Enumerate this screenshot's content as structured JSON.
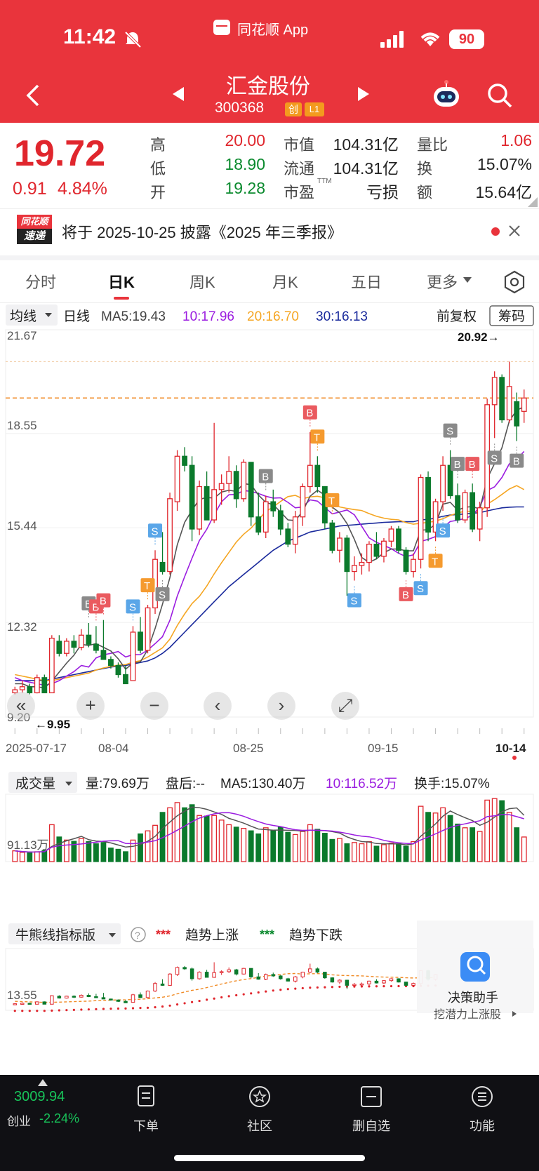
{
  "status_bar": {
    "time": "11:42",
    "battery": "90",
    "app_title": "同花顺 App"
  },
  "header": {
    "stock_name": "汇金股份",
    "stock_code": "300368",
    "badge_board": "创",
    "badge_level": "L1"
  },
  "quote": {
    "price": "19.72",
    "change": "0.91",
    "change_pct": "4.84%",
    "high_label": "高",
    "high": "20.00",
    "low_label": "低",
    "low": "18.90",
    "open_label": "开",
    "open": "19.28",
    "mktcap_label": "市值",
    "mktcap": "104.31亿",
    "float_label": "流通",
    "float_cap": "104.31亿",
    "pe_label": "市盈",
    "pe_sup": "TTM",
    "pe": "亏损",
    "vol_ratio_label": "量比",
    "vol_ratio": "1.06",
    "turnover_label": "换",
    "turnover": "15.07%",
    "amount_label": "额",
    "amount": "15.64亿"
  },
  "notice": {
    "logo_top": "同花顺",
    "logo_bottom": "速递",
    "text": "将于 2025-10-25 披露《2025 年三季报》"
  },
  "tabs": [
    "分时",
    "日K",
    "周K",
    "月K",
    "五日",
    "更多"
  ],
  "active_tab": 1,
  "kline": {
    "ma_selector": "均线",
    "period": "日线",
    "ma5": "MA5:19.43",
    "ma10": "10:17.96",
    "ma20": "20:16.70",
    "ma30": "30:16.13",
    "adjust": "前复权",
    "chips": "筹码",
    "y_labels": [
      "21.67",
      "18.55",
      "15.44",
      "12.32",
      "9.20"
    ],
    "high_note": "20.92→",
    "low_note": "←9.95",
    "dates": [
      "2025-07-17",
      "08-04",
      "08-25",
      "09-15",
      "10-14"
    ]
  },
  "volume": {
    "selector": "成交量",
    "vol": "量:79.69万",
    "after_hours": "盘后:--",
    "ma5": "MA5:130.40万",
    "ma10": "10:116.52万",
    "turnover": "换手:15.07%",
    "y_label": "91.13万"
  },
  "indicator": {
    "selector": "牛熊线指标版",
    "up_label": "趋势上涨",
    "down_label": "趋势下跌",
    "y_label": "13.55",
    "assistant_title": "决策助手",
    "assistant_sub": "挖潜力上涨股"
  },
  "bottom_bar": {
    "index_value": "3009.94",
    "index_name": "创业",
    "index_change": "-2.24%",
    "items": [
      "下单",
      "社区",
      "删自选",
      "功能"
    ]
  },
  "colors": {
    "up": "#e0262d",
    "down": "#0b7a2c",
    "ma5": "#555555",
    "ma10": "#9b1de0",
    "ma20": "#f5a623",
    "ma30": "#1a2a9c"
  },
  "chart_data": {
    "type": "candlestick",
    "title": "",
    "xlabel": "",
    "ylabel": "",
    "ylim": [
      9.2,
      21.67
    ],
    "x_ticks": [
      "2025-07-17",
      "08-04",
      "08-25",
      "09-15",
      "10-14"
    ],
    "candles": [
      [
        10.0,
        10.2,
        9.95,
        10.1
      ],
      [
        10.1,
        10.4,
        10.0,
        10.2
      ],
      [
        10.2,
        10.3,
        9.95,
        10.0
      ],
      [
        10.0,
        10.6,
        9.98,
        10.5
      ],
      [
        10.5,
        10.6,
        10.0,
        10.0
      ],
      [
        10.0,
        11.9,
        10.0,
        11.8
      ],
      [
        11.7,
        11.9,
        11.2,
        11.3
      ],
      [
        11.3,
        11.8,
        11.2,
        11.7
      ],
      [
        11.7,
        11.9,
        11.3,
        11.5
      ],
      [
        11.5,
        12.1,
        11.4,
        11.9
      ],
      [
        11.9,
        12.3,
        11.5,
        11.6
      ],
      [
        11.6,
        12.2,
        11.3,
        11.4
      ],
      [
        11.4,
        12.4,
        11.1,
        11.1
      ],
      [
        11.1,
        11.2,
        10.8,
        10.9
      ],
      [
        10.9,
        11.0,
        10.5,
        10.6
      ],
      [
        10.6,
        10.9,
        10.3,
        10.3
      ],
      [
        10.4,
        12.2,
        10.4,
        12.0
      ],
      [
        12.0,
        12.5,
        11.3,
        11.4
      ],
      [
        11.4,
        12.9,
        11.3,
        12.8
      ],
      [
        12.8,
        14.7,
        12.6,
        14.4
      ],
      [
        14.3,
        15.3,
        13.9,
        14.0
      ],
      [
        14.0,
        16.6,
        13.9,
        16.4
      ],
      [
        16.3,
        18.0,
        16.0,
        17.8
      ],
      [
        17.8,
        18.1,
        17.3,
        17.5
      ],
      [
        17.5,
        17.8,
        15.0,
        15.4
      ],
      [
        15.4,
        17.0,
        15.2,
        16.8
      ],
      [
        16.8,
        17.3,
        15.7,
        15.7
      ],
      [
        15.7,
        18.9,
        15.6,
        16.7
      ],
      [
        16.7,
        17.2,
        16.2,
        16.9
      ],
      [
        16.9,
        17.8,
        16.6,
        17.3
      ],
      [
        17.3,
        17.5,
        16.1,
        16.4
      ],
      [
        16.4,
        17.7,
        16.3,
        17.6
      ],
      [
        17.6,
        17.6,
        15.5,
        15.8
      ],
      [
        15.8,
        16.6,
        15.2,
        15.3
      ],
      [
        15.3,
        16.5,
        15.1,
        16.3
      ],
      [
        16.3,
        16.7,
        15.8,
        16.0
      ],
      [
        16.0,
        16.2,
        15.2,
        15.4
      ],
      [
        15.4,
        15.6,
        14.8,
        14.9
      ],
      [
        14.9,
        16.0,
        14.6,
        15.8
      ],
      [
        15.8,
        16.9,
        15.5,
        16.8
      ],
      [
        16.8,
        18.6,
        16.6,
        17.5
      ],
      [
        17.5,
        17.8,
        16.6,
        16.8
      ],
      [
        16.8,
        16.8,
        15.4,
        15.6
      ],
      [
        15.6,
        15.7,
        14.6,
        14.7
      ],
      [
        14.7,
        15.3,
        14.3,
        15.1
      ],
      [
        15.1,
        15.2,
        13.2,
        14.0
      ],
      [
        14.0,
        14.5,
        13.7,
        14.2
      ],
      [
        14.2,
        14.6,
        13.9,
        14.3
      ],
      [
        14.3,
        15.0,
        14.0,
        14.9
      ],
      [
        14.9,
        15.3,
        14.4,
        14.5
      ],
      [
        14.5,
        15.1,
        14.3,
        15.0
      ],
      [
        15.0,
        15.5,
        14.8,
        15.4
      ],
      [
        15.4,
        15.5,
        14.6,
        14.7
      ],
      [
        14.7,
        14.8,
        13.9,
        14.0
      ],
      [
        14.0,
        14.6,
        13.8,
        14.4
      ],
      [
        14.4,
        17.2,
        14.1,
        17.1
      ],
      [
        17.1,
        17.3,
        15.0,
        15.3
      ],
      [
        15.3,
        16.4,
        15.0,
        16.3
      ],
      [
        16.3,
        17.8,
        16.0,
        17.5
      ],
      [
        17.5,
        18.0,
        16.4,
        16.5
      ],
      [
        16.5,
        16.9,
        15.6,
        15.7
      ],
      [
        15.7,
        16.7,
        15.6,
        16.6
      ],
      [
        16.6,
        16.9,
        15.3,
        15.4
      ],
      [
        15.4,
        16.3,
        15.0,
        16.1
      ],
      [
        16.1,
        19.7,
        15.8,
        19.5
      ],
      [
        19.5,
        20.6,
        18.4,
        20.4
      ],
      [
        20.4,
        20.5,
        18.9,
        19.0
      ],
      [
        19.0,
        20.92,
        18.9,
        20.1
      ],
      [
        19.6,
        19.9,
        18.3,
        18.8
      ],
      [
        19.28,
        20.0,
        18.9,
        19.72
      ]
    ],
    "ma5": [
      10.3,
      10.3,
      10.2,
      10.2,
      10.16,
      10.38,
      10.68,
      10.98,
      11.24,
      11.6,
      11.56,
      11.62,
      11.5,
      11.38,
      11.12,
      10.78,
      10.98,
      11.02,
      11.42,
      12.12,
      12.92,
      13.8,
      14.88,
      15.62,
      16.02,
      16.38,
      16.44,
      16.42,
      16.62,
      16.68,
      16.64,
      16.9,
      16.86,
      16.52,
      16.28,
      16.2,
      15.96,
      15.7,
      15.68,
      15.98,
      16.48,
      16.68,
      16.52,
      16.12,
      15.94,
      15.58,
      15.06,
      14.46,
      14.3,
      14.42,
      14.62,
      14.74,
      14.74,
      14.68,
      14.68,
      15.36,
      15.38,
      15.56,
      16.22,
      16.28,
      16.02,
      16.12,
      16.14,
      16.06,
      17.06,
      17.56,
      18.08,
      18.96,
      19.32,
      19.43
    ],
    "ma10": [
      10.5,
      10.4,
      10.35,
      10.3,
      10.25,
      10.3,
      10.4,
      10.55,
      10.7,
      10.9,
      10.85,
      11.15,
      11.25,
      11.3,
      11.36,
      11.18,
      11.26,
      11.26,
      11.41,
      11.62,
      11.85,
      12.39,
      13.19,
      13.83,
      14.44,
      15.02,
      15.39,
      15.87,
      16.3,
      16.53,
      16.54,
      16.67,
      16.64,
      16.57,
      16.48,
      16.42,
      16.43,
      16.28,
      16.1,
      16.13,
      16.36,
      16.32,
      16.11,
      15.9,
      15.96,
      16.03,
      15.87,
      15.49,
      15.11,
      14.96,
      14.86,
      14.75,
      14.6,
      14.49,
      14.55,
      14.99,
      15.06,
      15.15,
      15.45,
      15.65,
      15.69,
      15.75,
      15.85,
      16.14,
      16.67,
      16.79,
      17.1,
      17.55,
      17.7,
      17.96
    ],
    "ma20": [
      10.6,
      10.55,
      10.5,
      10.45,
      10.4,
      10.4,
      10.45,
      10.5,
      10.55,
      10.6,
      10.65,
      10.75,
      10.82,
      10.87,
      10.91,
      10.93,
      11.01,
      11.06,
      11.18,
      11.33,
      11.48,
      11.77,
      12.22,
      12.6,
      12.94,
      13.18,
      13.52,
      13.92,
      14.29,
      14.63,
      14.97,
      15.23,
      15.43,
      15.7,
      15.98,
      16.13,
      16.31,
      16.47,
      16.51,
      16.4,
      16.46,
      16.48,
      16.43,
      16.23,
      16.13,
      16.08,
      16.04,
      16.01,
      15.91,
      15.82,
      15.76,
      15.72,
      15.7,
      15.61,
      15.56,
      15.59,
      15.62,
      15.66,
      15.74,
      15.85,
      15.93,
      15.99,
      15.98,
      15.95,
      16.22,
      16.37,
      16.54,
      16.72,
      16.83,
      16.7
    ],
    "ma30": [
      10.4,
      10.4,
      10.4,
      10.4,
      10.4,
      10.45,
      10.5,
      10.55,
      10.6,
      10.65,
      10.7,
      10.75,
      10.8,
      10.85,
      10.88,
      10.9,
      10.95,
      11.0,
      11.05,
      11.15,
      11.3,
      11.5,
      11.75,
      12.0,
      12.25,
      12.5,
      12.75,
      13.0,
      13.25,
      13.5,
      13.7,
      13.9,
      14.1,
      14.3,
      14.5,
      14.7,
      14.85,
      15.0,
      15.1,
      15.2,
      15.3,
      15.35,
      15.4,
      15.45,
      15.5,
      15.52,
      15.54,
      15.56,
      15.58,
      15.6,
      15.62,
      15.63,
      15.64,
      15.64,
      15.64,
      15.7,
      15.72,
      15.76,
      15.82,
      15.86,
      15.88,
      15.9,
      15.92,
      15.94,
      16.0,
      16.05,
      16.1,
      16.12,
      16.13,
      16.13
    ],
    "volume": [
      35,
      30,
      28,
      32,
      36,
      120,
      80,
      70,
      66,
      75,
      65,
      58,
      62,
      44,
      40,
      32,
      70,
      90,
      100,
      118,
      160,
      175,
      192,
      175,
      185,
      150,
      148,
      150,
      135,
      120,
      112,
      108,
      100,
      90,
      110,
      102,
      112,
      95,
      88,
      98,
      120,
      105,
      92,
      72,
      75,
      58,
      62,
      58,
      65,
      50,
      55,
      60,
      58,
      50,
      65,
      180,
      160,
      158,
      175,
      150,
      122,
      110,
      110,
      98,
      200,
      205,
      198,
      160,
      110,
      80
    ],
    "signals": [
      {
        "i": 10,
        "label": "B",
        "color": "gray",
        "pos": "above"
      },
      {
        "i": 11,
        "label": "B",
        "color": "red",
        "pos": "above"
      },
      {
        "i": 12,
        "label": "B",
        "color": "red",
        "pos": "above"
      },
      {
        "i": 16,
        "label": "S",
        "color": "blue",
        "pos": "above"
      },
      {
        "i": 18,
        "label": "T",
        "color": "orange",
        "pos": "above"
      },
      {
        "i": 20,
        "label": "S",
        "color": "gray",
        "pos": "below"
      },
      {
        "i": 19,
        "label": "S",
        "color": "blue",
        "pos": "above"
      },
      {
        "i": 34,
        "label": "B",
        "color": "gray",
        "pos": "above"
      },
      {
        "i": 40,
        "label": "B",
        "color": "red",
        "pos": "above"
      },
      {
        "i": 41,
        "label": "T",
        "color": "orange",
        "pos": "above"
      },
      {
        "i": 43,
        "label": "T",
        "color": "orange",
        "pos": "above"
      },
      {
        "i": 46,
        "label": "S",
        "color": "blue",
        "pos": "below"
      },
      {
        "i": 53,
        "label": "B",
        "color": "red",
        "pos": "below"
      },
      {
        "i": 55,
        "label": "S",
        "color": "blue",
        "pos": "below"
      },
      {
        "i": 57,
        "label": "T",
        "color": "orange",
        "pos": "below"
      },
      {
        "i": 58,
        "label": "S",
        "color": "blue",
        "pos": "below"
      },
      {
        "i": 59,
        "label": "S",
        "color": "gray",
        "pos": "above"
      },
      {
        "i": 60,
        "label": "B",
        "color": "gray",
        "pos": "above"
      },
      {
        "i": 62,
        "label": "B",
        "color": "red",
        "pos": "above"
      },
      {
        "i": 65,
        "label": "S",
        "color": "gray",
        "pos": "below"
      },
      {
        "i": 68,
        "label": "B",
        "color": "gray",
        "pos": "below"
      }
    ]
  }
}
